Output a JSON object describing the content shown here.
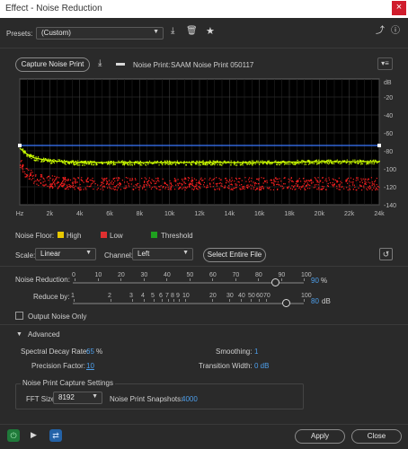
{
  "window": {
    "title": "Effect - Noise Reduction",
    "close_glyph": "×"
  },
  "presets": {
    "label": "Presets:",
    "value": "(Custom)"
  },
  "capture": {
    "button_label": "Capture Noise Print",
    "noise_print_label": "Noise Print:",
    "noise_print_value": "SAAM Noise Print 050117"
  },
  "graph": {
    "y_unit": "dB",
    "y_ticks": [
      "-20",
      "-40",
      "-60",
      "-80",
      "-100",
      "-120",
      "-140"
    ],
    "x_ticks": [
      "Hz",
      "2k",
      "4k",
      "6k",
      "8k",
      "10k",
      "12k",
      "14k",
      "16k",
      "18k",
      "20k",
      "22k",
      "24k"
    ]
  },
  "chart_data": {
    "type": "line",
    "xlabel": "",
    "ylabel": "",
    "xlim": [
      0,
      24000
    ],
    "ylim": [
      -140,
      0
    ],
    "y_unit_label": "dB",
    "grid": true,
    "series": [
      {
        "name": "Threshold",
        "color": "#3a78ff",
        "x": [
          0,
          24000
        ],
        "y": [
          -74,
          -74
        ]
      },
      {
        "name": "High",
        "color": "#ccff00",
        "x": [
          0,
          500,
          1000,
          2000,
          3000,
          4000,
          6000,
          8000,
          12000,
          16000,
          20000,
          24000
        ],
        "y": [
          -77,
          -84,
          -88,
          -91,
          -92,
          -93,
          -93,
          -93,
          -93,
          -93,
          -92,
          -92
        ]
      },
      {
        "name": "Low",
        "color": "#ff2020",
        "x": [
          0,
          500,
          1000,
          2000,
          3000,
          4000,
          6000,
          8000,
          12000,
          16000,
          20000,
          24000
        ],
        "y": [
          -95,
          -105,
          -110,
          -114,
          -115,
          -116,
          -116,
          -116,
          -116,
          -116,
          -116,
          -116
        ]
      }
    ]
  },
  "legend": {
    "label": "Noise Floor:",
    "items": [
      {
        "label": "High",
        "color": "#e8c800"
      },
      {
        "label": "Low",
        "color": "#e03030"
      },
      {
        "label": "Threshold",
        "color": "#1fa01f"
      }
    ]
  },
  "scale": {
    "label": "Scale:",
    "value": "Linear"
  },
  "channel": {
    "label": "Channel:",
    "value": "Left"
  },
  "select_entire_file": "Select Entire File",
  "noise_reduction": {
    "label": "Noise Reduction:",
    "value": "90",
    "unit": "%",
    "ticks": [
      "0",
      "10",
      "20",
      "30",
      "40",
      "50",
      "60",
      "70",
      "80",
      "90",
      "100"
    ]
  },
  "reduce_by": {
    "label": "Reduce by:",
    "value": "80",
    "unit": "dB",
    "ticks": [
      "1",
      "2",
      "3",
      "4",
      "5",
      "6",
      "7",
      "8",
      "9",
      "10",
      "20",
      "30",
      "40",
      "50",
      "60",
      "70",
      "100"
    ]
  },
  "output_noise_only": "Output Noise Only",
  "advanced": {
    "header": "Advanced",
    "spectral_decay_label": "Spectral Decay Rate:",
    "spectral_decay_value": "65",
    "spectral_decay_unit": "%",
    "smoothing_label": "Smoothing:",
    "smoothing_value": "1",
    "precision_label": "Precision Factor:",
    "precision_value": "10",
    "transition_label": "Transition Width:",
    "transition_value": "0 dB"
  },
  "capture_settings": {
    "title": "Noise Print Capture Settings",
    "fft_label": "FFT Size:",
    "fft_value": "8192",
    "snapshots_label": "Noise Print Snapshots:",
    "snapshots_value": "4000"
  },
  "footer": {
    "apply": "Apply",
    "close": "Close"
  }
}
